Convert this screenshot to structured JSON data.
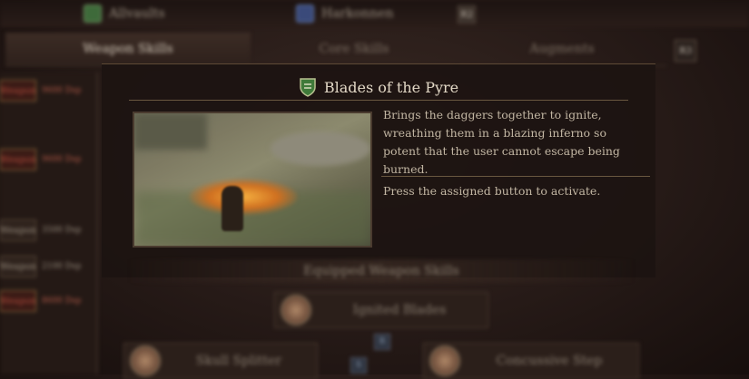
{
  "top_bar": {
    "items": [
      {
        "label": "Allvaults",
        "icon": "vocation-icon"
      },
      {
        "label": "Harkonnen",
        "icon": "character-icon"
      }
    ],
    "badge": "R2"
  },
  "tabs": [
    {
      "label": "Weapon Skills",
      "active": true
    },
    {
      "label": "Core Skills",
      "active": false
    },
    {
      "label": "Augments",
      "active": false
    }
  ],
  "tab_badge": "R3",
  "left_list": [
    {
      "label": "Weapon",
      "value": "9600 Dsp",
      "alert": true
    },
    {
      "label": "Weapon",
      "value": "9600 Dsp",
      "alert": true
    },
    {
      "label": "Weapon",
      "value": "3500 Dsp",
      "alert": false
    },
    {
      "label": "Weapon",
      "value": "2100 Dsp",
      "alert": false
    },
    {
      "label": "Weapon",
      "value": "8600 Dsp",
      "alert": true
    }
  ],
  "skill": {
    "title": "Blades of the Pyre",
    "icon": "shield-emblem-icon",
    "description": "Brings the daggers together to ignite, wreathing them in a blazing inferno so potent that the user cannot escape being burned.",
    "hint": "Press the assigned button to activate."
  },
  "equipped": {
    "header": "Equipped Weapon Skills",
    "slots": [
      {
        "label": "Ignited Blades"
      },
      {
        "label": "Skull Splitter"
      },
      {
        "label": "Concussive Step"
      }
    ],
    "buttons": [
      "R",
      "S"
    ]
  },
  "colors": {
    "accent": "#6a5840",
    "background": "#261a17",
    "text": "#c2b6a3",
    "alert": "#b45a48"
  }
}
